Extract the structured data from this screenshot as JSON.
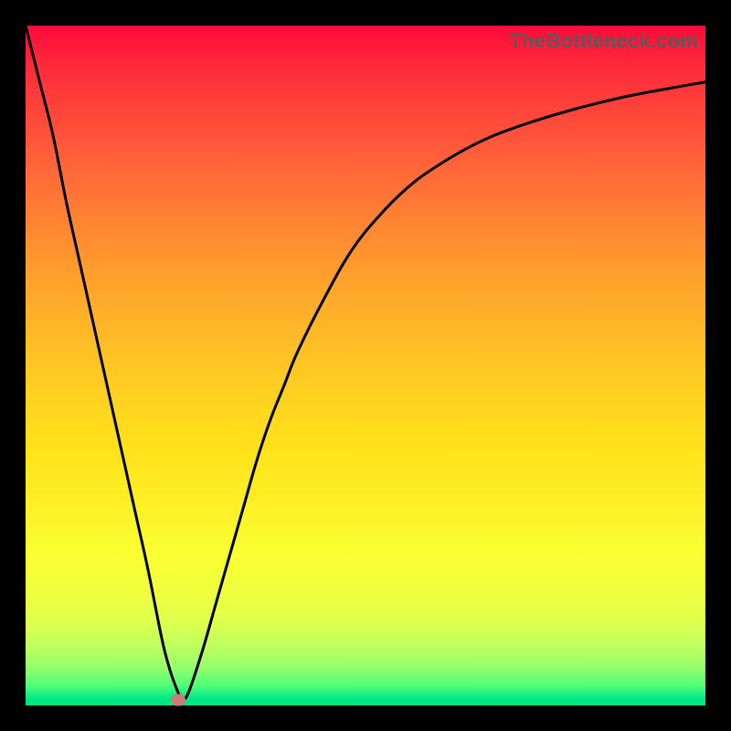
{
  "watermark": "TheBottleneck.com",
  "colors": {
    "frame": "#000000",
    "curve": "#000000",
    "marker": "#cb7d78",
    "gradient_top": "#ff0a3a",
    "gradient_bottom": "#00e678"
  },
  "chart_data": {
    "type": "line",
    "title": "",
    "xlabel": "",
    "ylabel": "",
    "xlim": [
      0,
      100
    ],
    "ylim": [
      0,
      100
    ],
    "grid": false,
    "legend": false,
    "series": [
      {
        "name": "bottleneck-curve",
        "x": [
          0,
          2,
          4,
          6,
          8,
          10,
          12,
          14,
          16,
          18,
          20,
          21,
          22,
          23,
          24,
          26,
          28,
          30,
          32,
          34,
          36,
          38,
          40,
          44,
          48,
          52,
          56,
          60,
          66,
          72,
          80,
          88,
          96,
          100
        ],
        "y": [
          100,
          92,
          84,
          74,
          65,
          56,
          47,
          38,
          29,
          20,
          10,
          6,
          3,
          1,
          2,
          8,
          15,
          22,
          29,
          36,
          42,
          47,
          52,
          60,
          67,
          72,
          76,
          79,
          82.5,
          85,
          87.5,
          89.5,
          91,
          91.7
        ]
      }
    ],
    "marker": {
      "x": 22.5,
      "y": 0.8
    }
  }
}
